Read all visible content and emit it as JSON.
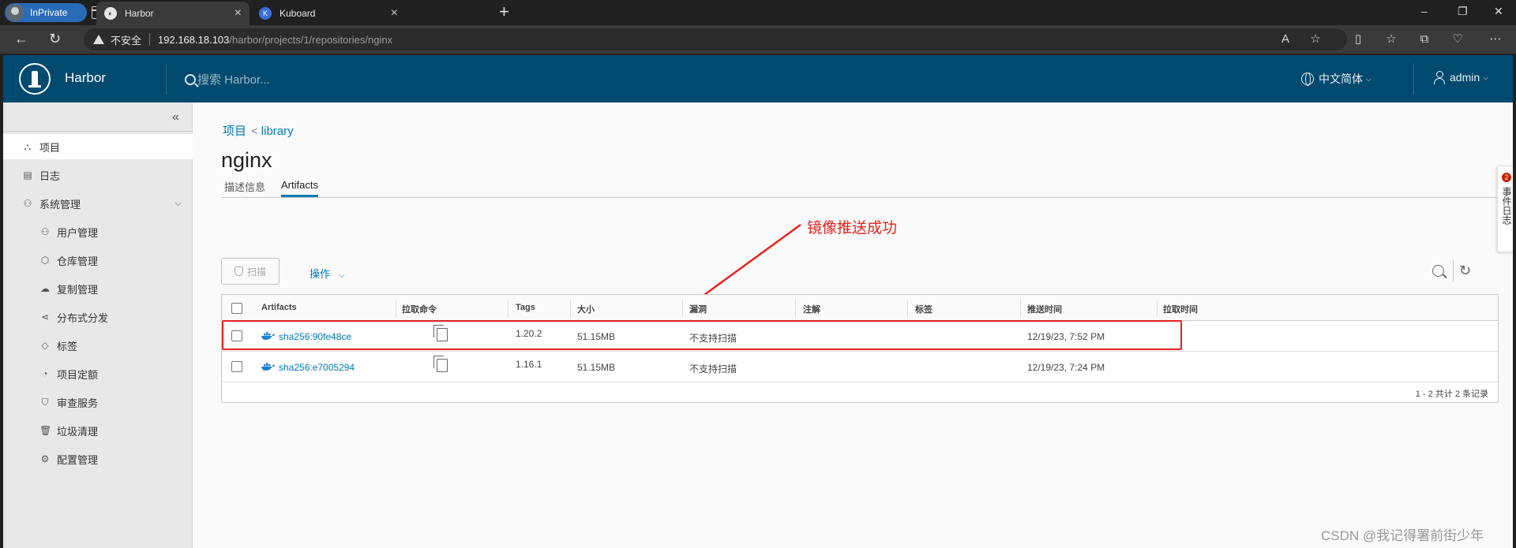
{
  "browser": {
    "inprivate_label": "InPrivate",
    "tabs": [
      {
        "title": "Harbor",
        "active": true
      },
      {
        "title": "Kuboard",
        "active": false
      }
    ],
    "address": {
      "security_label": "不安全",
      "host": "192.168.18.103",
      "path": "/harbor/projects/1/repositories/nginx"
    }
  },
  "header": {
    "brand": "Harbor",
    "search_placeholder": "搜索 Harbor...",
    "language": "中文简体",
    "user": "admin",
    "bg_color": "#004a70"
  },
  "sidebar": {
    "items": [
      {
        "label": "项目",
        "icon": "project-icon",
        "active": true
      },
      {
        "label": "日志",
        "icon": "log-icon"
      },
      {
        "label": "系统管理",
        "icon": "admin-icon",
        "expandable": true
      },
      {
        "label": "用户管理",
        "icon": "users-icon",
        "sub": true
      },
      {
        "label": "仓库管理",
        "icon": "registry-icon",
        "sub": true
      },
      {
        "label": "复制管理",
        "icon": "cloud-icon",
        "sub": true
      },
      {
        "label": "分布式分发",
        "icon": "share-icon",
        "sub": true
      },
      {
        "label": "标签",
        "icon": "tag-icon",
        "sub": true
      },
      {
        "label": "项目定额",
        "icon": "quota-icon",
        "sub": true
      },
      {
        "label": "审查服务",
        "icon": "shield-icon",
        "sub": true
      },
      {
        "label": "垃圾清理",
        "icon": "trash-icon",
        "sub": true
      },
      {
        "label": "配置管理",
        "icon": "gear-icon",
        "sub": true
      }
    ]
  },
  "main": {
    "breadcrumb": {
      "root": "项目",
      "sep": "<",
      "child": "library"
    },
    "title": "nginx",
    "tabs": [
      {
        "label": "描述信息",
        "active": false
      },
      {
        "label": "Artifacts",
        "active": true
      }
    ],
    "annotation": "镜像推送成功",
    "toolbar": {
      "scan": "扫描",
      "actions": "操作"
    },
    "table": {
      "columns": [
        "Artifacts",
        "拉取命令",
        "Tags",
        "大小",
        "漏洞",
        "注解",
        "标签",
        "推送时间",
        "拉取时间"
      ],
      "rows": [
        {
          "artifact": "sha256:90fe48ce",
          "tags": "1.20.2",
          "size": "51.15MB",
          "vuln": "不支持扫描",
          "push_time": "12/19/23, 7:52 PM",
          "pull_time": ""
        },
        {
          "artifact": "sha256:e7005294",
          "tags": "1.16.1",
          "size": "51.15MB",
          "vuln": "不支持扫描",
          "push_time": "12/19/23, 7:24 PM",
          "pull_time": ""
        }
      ],
      "footer": "1 - 2 共计 2 条记录"
    }
  },
  "event_log": {
    "label": "事件日志",
    "count": "2"
  },
  "watermark": "CSDN @我记得署前街少年",
  "colors": {
    "accent": "#0079b8",
    "annotation_red": "#e8231f"
  }
}
